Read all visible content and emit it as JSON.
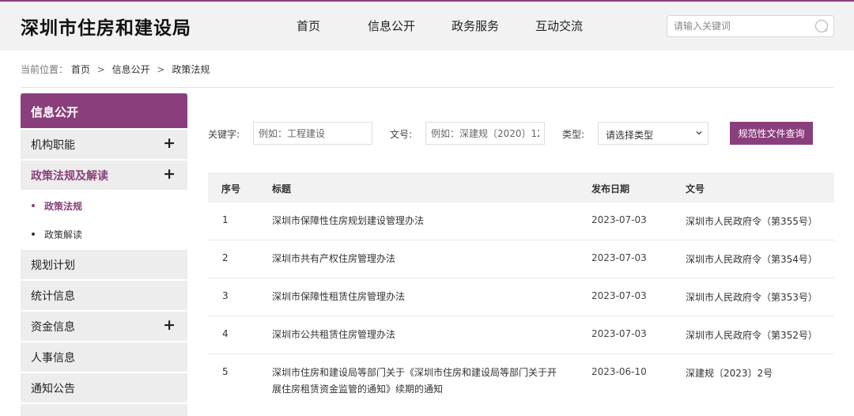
{
  "header": {
    "site_title": "深圳市住房和建设局",
    "nav": [
      "首页",
      "信息公开",
      "政务服务",
      "互动交流"
    ],
    "search_placeholder": "请输入关键词"
  },
  "breadcrumb": {
    "label": "当前位置：",
    "items": [
      "首页",
      "信息公开",
      "政策法规"
    ],
    "separator": ">"
  },
  "sidebar": {
    "header": "信息公开",
    "items": [
      {
        "label": "机构职能",
        "has_plus": true
      },
      {
        "label": "政策法规及解读",
        "has_plus": true,
        "active": true
      },
      {
        "label": "规划计划",
        "has_plus": false
      },
      {
        "label": "统计信息",
        "has_plus": false
      },
      {
        "label": "资金信息",
        "has_plus": true
      },
      {
        "label": "人事信息",
        "has_plus": false
      },
      {
        "label": "通知公告",
        "has_plus": false
      }
    ],
    "subitems": [
      {
        "label": "政策法规",
        "active": true
      },
      {
        "label": "政策解读",
        "active": false
      }
    ],
    "plus_symbol": "+"
  },
  "filter": {
    "keyword_label": "关键字:",
    "keyword_placeholder": "例如：工程建设",
    "docno_label": "文号:",
    "docno_placeholder": "例如：深建规〔2020〕12",
    "type_label": "类型:",
    "type_selected": "请选择类型",
    "query_button": "规范性文件查询"
  },
  "table": {
    "headers": [
      "序号",
      "标题",
      "发布日期",
      "文号"
    ],
    "rows": [
      {
        "no": "1",
        "title": "深圳市保障性住房规划建设管理办法",
        "date": "2023-07-03",
        "docno": "深圳市人民政府令（第355号）"
      },
      {
        "no": "2",
        "title": "深圳市共有产权住房管理办法",
        "date": "2023-07-03",
        "docno": "深圳市人民政府令（第354号）"
      },
      {
        "no": "3",
        "title": "深圳市保障性租赁住房管理办法",
        "date": "2023-07-03",
        "docno": "深圳市人民政府令（第353号）"
      },
      {
        "no": "4",
        "title": "深圳市公共租赁住房管理办法",
        "date": "2023-07-03",
        "docno": "深圳市人民政府令（第352号）"
      },
      {
        "no": "5",
        "title": "深圳市住房和建设局等部门关于《深圳市住房和建设局等部门关于开展住房租赁资金监管的通知》续期的通知",
        "date": "2023-06-10",
        "docno": "深建规〔2023〕2号"
      }
    ]
  },
  "colors": {
    "accent": "#8a3f7c",
    "header_bg": "#f2f2f2",
    "sidebar_item_bg": "#ededed"
  },
  "icons": {
    "search": "search-icon",
    "select": "chevron-down-icon"
  }
}
